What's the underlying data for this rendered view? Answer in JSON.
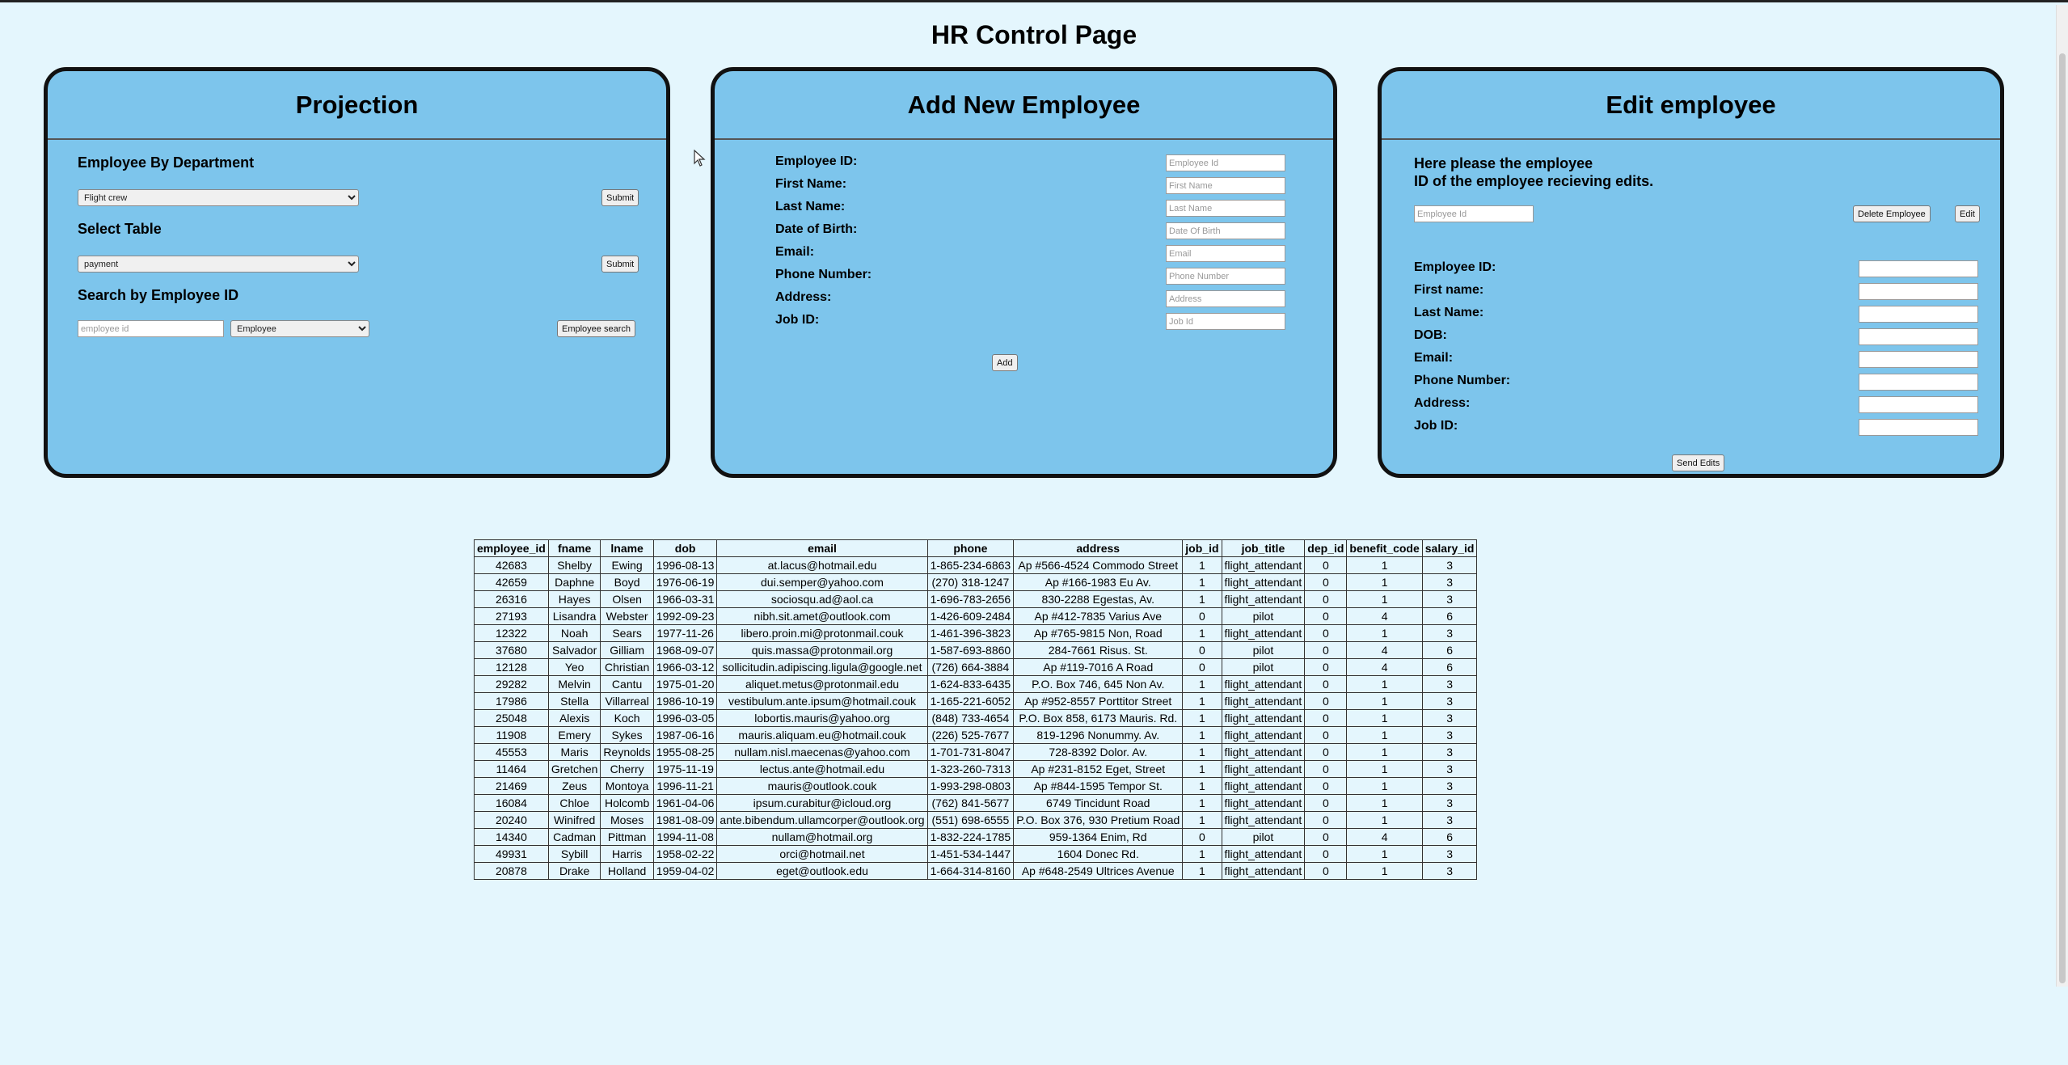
{
  "page": {
    "title": "HR Control Page"
  },
  "projection": {
    "title": "Projection",
    "by_department": {
      "label": "Employee By Department",
      "selected": "Flight crew",
      "submit": "Submit"
    },
    "select_table": {
      "label": "Select Table",
      "selected": "payment",
      "submit": "Submit"
    },
    "search": {
      "label": "Search by Employee ID",
      "placeholder": "employee id",
      "selected": "Employee",
      "button": "Employee search"
    }
  },
  "add_employee": {
    "title": "Add New Employee",
    "fields": [
      {
        "label": "Employee ID:",
        "placeholder": "Employee Id"
      },
      {
        "label": "First Name:",
        "placeholder": "First Name"
      },
      {
        "label": "Last Name:",
        "placeholder": "Last Name"
      },
      {
        "label": "Date of Birth:",
        "placeholder": "Date Of Birth"
      },
      {
        "label": "Email:",
        "placeholder": "Email"
      },
      {
        "label": "Phone Number:",
        "placeholder": "Phone Number"
      },
      {
        "label": "Address:",
        "placeholder": "Address"
      },
      {
        "label": "Job ID:",
        "placeholder": "Job Id"
      }
    ],
    "add_button": "Add"
  },
  "edit_employee": {
    "title": "Edit employee",
    "instructions_line1": "Here please the employee",
    "instructions_line2": "ID of the employee recieving edits.",
    "id_placeholder": "Employee Id",
    "delete_button": "Delete Employee",
    "edit_button": "Edit",
    "fields": [
      {
        "label": "Employee ID:"
      },
      {
        "label": "First name:"
      },
      {
        "label": "Last Name:"
      },
      {
        "label": "DOB:"
      },
      {
        "label": "Email:"
      },
      {
        "label": "Phone Number:"
      },
      {
        "label": "Address:"
      },
      {
        "label": "Job ID:"
      }
    ],
    "send_button": "Send Edits"
  },
  "table": {
    "columns": [
      "employee_id",
      "fname",
      "lname",
      "dob",
      "email",
      "phone",
      "address",
      "job_id",
      "job_title",
      "dep_id",
      "benefit_code",
      "salary_id"
    ],
    "rows": [
      [
        "42683",
        "Shelby",
        "Ewing",
        "1996-08-13",
        "at.lacus@hotmail.edu",
        "1-865-234-6863",
        "Ap #566-4524 Commodo Street",
        "1",
        "flight_attendant",
        "0",
        "1",
        "3"
      ],
      [
        "42659",
        "Daphne",
        "Boyd",
        "1976-06-19",
        "dui.semper@yahoo.com",
        "(270) 318-1247",
        "Ap #166-1983 Eu Av.",
        "1",
        "flight_attendant",
        "0",
        "1",
        "3"
      ],
      [
        "26316",
        "Hayes",
        "Olsen",
        "1966-03-31",
        "sociosqu.ad@aol.ca",
        "1-696-783-2656",
        "830-2288 Egestas, Av.",
        "1",
        "flight_attendant",
        "0",
        "1",
        "3"
      ],
      [
        "27193",
        "Lisandra",
        "Webster",
        "1992-09-23",
        "nibh.sit.amet@outlook.com",
        "1-426-609-2484",
        "Ap #412-7835 Varius Ave",
        "0",
        "pilot",
        "0",
        "4",
        "6"
      ],
      [
        "12322",
        "Noah",
        "Sears",
        "1977-11-26",
        "libero.proin.mi@protonmail.couk",
        "1-461-396-3823",
        "Ap #765-9815 Non, Road",
        "1",
        "flight_attendant",
        "0",
        "1",
        "3"
      ],
      [
        "37680",
        "Salvador",
        "Gilliam",
        "1968-09-07",
        "quis.massa@protonmail.org",
        "1-587-693-8860",
        "284-7661 Risus. St.",
        "0",
        "pilot",
        "0",
        "4",
        "6"
      ],
      [
        "12128",
        "Yeo",
        "Christian",
        "1966-03-12",
        "sollicitudin.adipiscing.ligula@google.net",
        "(726) 664-3884",
        "Ap #119-7016 A Road",
        "0",
        "pilot",
        "0",
        "4",
        "6"
      ],
      [
        "29282",
        "Melvin",
        "Cantu",
        "1975-01-20",
        "aliquet.metus@protonmail.edu",
        "1-624-833-6435",
        "P.O. Box 746, 645 Non Av.",
        "1",
        "flight_attendant",
        "0",
        "1",
        "3"
      ],
      [
        "17986",
        "Stella",
        "Villarreal",
        "1986-10-19",
        "vestibulum.ante.ipsum@hotmail.couk",
        "1-165-221-6052",
        "Ap #952-8557 Porttitor Street",
        "1",
        "flight_attendant",
        "0",
        "1",
        "3"
      ],
      [
        "25048",
        "Alexis",
        "Koch",
        "1996-03-05",
        "lobortis.mauris@yahoo.org",
        "(848) 733-4654",
        "P.O. Box 858, 6173 Mauris. Rd.",
        "1",
        "flight_attendant",
        "0",
        "1",
        "3"
      ],
      [
        "11908",
        "Emery",
        "Sykes",
        "1987-06-16",
        "mauris.aliquam.eu@hotmail.couk",
        "(226) 525-7677",
        "819-1296 Nonummy. Av.",
        "1",
        "flight_attendant",
        "0",
        "1",
        "3"
      ],
      [
        "45553",
        "Maris",
        "Reynolds",
        "1955-08-25",
        "nullam.nisl.maecenas@yahoo.com",
        "1-701-731-8047",
        "728-8392 Dolor. Av.",
        "1",
        "flight_attendant",
        "0",
        "1",
        "3"
      ],
      [
        "11464",
        "Gretchen",
        "Cherry",
        "1975-11-19",
        "lectus.ante@hotmail.edu",
        "1-323-260-7313",
        "Ap #231-8152 Eget, Street",
        "1",
        "flight_attendant",
        "0",
        "1",
        "3"
      ],
      [
        "21469",
        "Zeus",
        "Montoya",
        "1996-11-21",
        "mauris@outlook.couk",
        "1-993-298-0803",
        "Ap #844-1595 Tempor St.",
        "1",
        "flight_attendant",
        "0",
        "1",
        "3"
      ],
      [
        "16084",
        "Chloe",
        "Holcomb",
        "1961-04-06",
        "ipsum.curabitur@icloud.org",
        "(762) 841-5677",
        "6749 Tincidunt Road",
        "1",
        "flight_attendant",
        "0",
        "1",
        "3"
      ],
      [
        "20240",
        "Winifred",
        "Moses",
        "1981-08-09",
        "ante.bibendum.ullamcorper@outlook.org",
        "(551) 698-6555",
        "P.O. Box 376, 930 Pretium Road",
        "1",
        "flight_attendant",
        "0",
        "1",
        "3"
      ],
      [
        "14340",
        "Cadman",
        "Pittman",
        "1994-11-08",
        "nullam@hotmail.org",
        "1-832-224-1785",
        "959-1364 Enim, Rd",
        "0",
        "pilot",
        "0",
        "4",
        "6"
      ],
      [
        "49931",
        "Sybill",
        "Harris",
        "1958-02-22",
        "orci@hotmail.net",
        "1-451-534-1447",
        "1604 Donec Rd.",
        "1",
        "flight_attendant",
        "0",
        "1",
        "3"
      ],
      [
        "20878",
        "Drake",
        "Holland",
        "1959-04-02",
        "eget@outlook.edu",
        "1-664-314-8160",
        "Ap #648-2549 Ultrices Avenue",
        "1",
        "flight_attendant",
        "0",
        "1",
        "3"
      ]
    ]
  }
}
